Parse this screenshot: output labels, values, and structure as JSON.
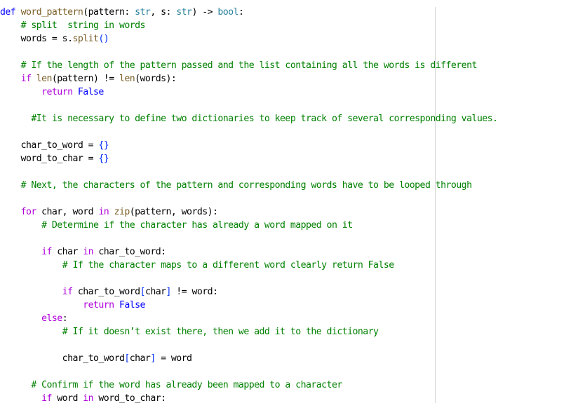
{
  "code": {
    "lines": [
      [
        {
          "t": "def",
          "c": "kw"
        },
        {
          "t": " ",
          "c": "pl"
        },
        {
          "t": "word_pattern",
          "c": "fn"
        },
        {
          "t": "(",
          "c": "pl"
        },
        {
          "t": "pattern",
          "c": "pl"
        },
        {
          "t": ": ",
          "c": "pl"
        },
        {
          "t": "str",
          "c": "bt"
        },
        {
          "t": ", ",
          "c": "pl"
        },
        {
          "t": "s",
          "c": "pl"
        },
        {
          "t": ": ",
          "c": "pl"
        },
        {
          "t": "str",
          "c": "bt"
        },
        {
          "t": ") -> ",
          "c": "pl"
        },
        {
          "t": "bool",
          "c": "bt"
        },
        {
          "t": ":",
          "c": "pl"
        }
      ],
      [
        {
          "t": "    ",
          "c": "pl"
        },
        {
          "t": "# split  string in words",
          "c": "cm"
        }
      ],
      [
        {
          "t": "    words = s.",
          "c": "pl"
        },
        {
          "t": "split",
          "c": "fn"
        },
        {
          "t": "()",
          "c": "br"
        }
      ],
      [],
      [
        {
          "t": "    ",
          "c": "pl"
        },
        {
          "t": "# If the length of the pattern passed and the list containing all the words is different",
          "c": "cm"
        }
      ],
      [
        {
          "t": "    ",
          "c": "pl"
        },
        {
          "t": "if",
          "c": "ctl"
        },
        {
          "t": " ",
          "c": "pl"
        },
        {
          "t": "len",
          "c": "fn"
        },
        {
          "t": "(",
          "c": "pl"
        },
        {
          "t": "pattern",
          "c": "pl"
        },
        {
          "t": ") != ",
          "c": "pl"
        },
        {
          "t": "len",
          "c": "fn"
        },
        {
          "t": "(",
          "c": "pl"
        },
        {
          "t": "words",
          "c": "pl"
        },
        {
          "t": "):",
          "c": "pl"
        }
      ],
      [
        {
          "t": "        ",
          "c": "pl"
        },
        {
          "t": "return",
          "c": "ctl"
        },
        {
          "t": " ",
          "c": "pl"
        },
        {
          "t": "False",
          "c": "kw"
        }
      ],
      [],
      [
        {
          "t": "      ",
          "c": "pl"
        },
        {
          "t": "#It is necessary to define two dictionaries to keep track of several corresponding values.",
          "c": "cm"
        }
      ],
      [],
      [
        {
          "t": "    char_to_word = ",
          "c": "pl"
        },
        {
          "t": "{}",
          "c": "br"
        }
      ],
      [
        {
          "t": "    word_to_char = ",
          "c": "pl"
        },
        {
          "t": "{}",
          "c": "br"
        }
      ],
      [],
      [
        {
          "t": "    ",
          "c": "pl"
        },
        {
          "t": "# Next, the characters of the pattern and corresponding words have to be looped through",
          "c": "cm"
        }
      ],
      [],
      [
        {
          "t": "    ",
          "c": "pl"
        },
        {
          "t": "for",
          "c": "ctl"
        },
        {
          "t": " char, word ",
          "c": "pl"
        },
        {
          "t": "in",
          "c": "ctl"
        },
        {
          "t": " ",
          "c": "pl"
        },
        {
          "t": "zip",
          "c": "fn"
        },
        {
          "t": "(",
          "c": "pl"
        },
        {
          "t": "pattern, words",
          "c": "pl"
        },
        {
          "t": "):",
          "c": "pl"
        }
      ],
      [
        {
          "t": "        ",
          "c": "pl"
        },
        {
          "t": "# Determine if the character has already a word mapped on it",
          "c": "cm"
        }
      ],
      [],
      [
        {
          "t": "        ",
          "c": "pl"
        },
        {
          "t": "if",
          "c": "ctl"
        },
        {
          "t": " char ",
          "c": "pl"
        },
        {
          "t": "in",
          "c": "ctl"
        },
        {
          "t": " char_to_word:",
          "c": "pl"
        }
      ],
      [
        {
          "t": "            ",
          "c": "pl"
        },
        {
          "t": "# If the character maps to a different word clearly return False",
          "c": "cm"
        }
      ],
      [],
      [
        {
          "t": "            ",
          "c": "pl"
        },
        {
          "t": "if",
          "c": "ctl"
        },
        {
          "t": " char_to_word",
          "c": "pl"
        },
        {
          "t": "[",
          "c": "br"
        },
        {
          "t": "char",
          "c": "pl"
        },
        {
          "t": "]",
          "c": "br"
        },
        {
          "t": " != word:",
          "c": "pl"
        }
      ],
      [
        {
          "t": "                ",
          "c": "pl"
        },
        {
          "t": "return",
          "c": "ctl"
        },
        {
          "t": " ",
          "c": "pl"
        },
        {
          "t": "False",
          "c": "kw"
        }
      ],
      [
        {
          "t": "        ",
          "c": "pl"
        },
        {
          "t": "else",
          "c": "ctl"
        },
        {
          "t": ":",
          "c": "pl"
        }
      ],
      [
        {
          "t": "            ",
          "c": "pl"
        },
        {
          "t": "# If it doesn’t exist there, then we add it to the dictionary",
          "c": "cm"
        }
      ],
      [],
      [
        {
          "t": "            char_to_word",
          "c": "pl"
        },
        {
          "t": "[",
          "c": "br"
        },
        {
          "t": "char",
          "c": "pl"
        },
        {
          "t": "]",
          "c": "br"
        },
        {
          "t": " = word",
          "c": "pl"
        }
      ],
      [],
      [
        {
          "t": "      ",
          "c": "pl"
        },
        {
          "t": "# Confirm if the word has already been mapped to a character",
          "c": "cm"
        }
      ],
      [
        {
          "t": "        ",
          "c": "pl"
        },
        {
          "t": "if",
          "c": "ctl"
        },
        {
          "t": " word ",
          "c": "pl"
        },
        {
          "t": "in",
          "c": "ctl"
        },
        {
          "t": " word_to_char:",
          "c": "pl"
        }
      ]
    ]
  }
}
